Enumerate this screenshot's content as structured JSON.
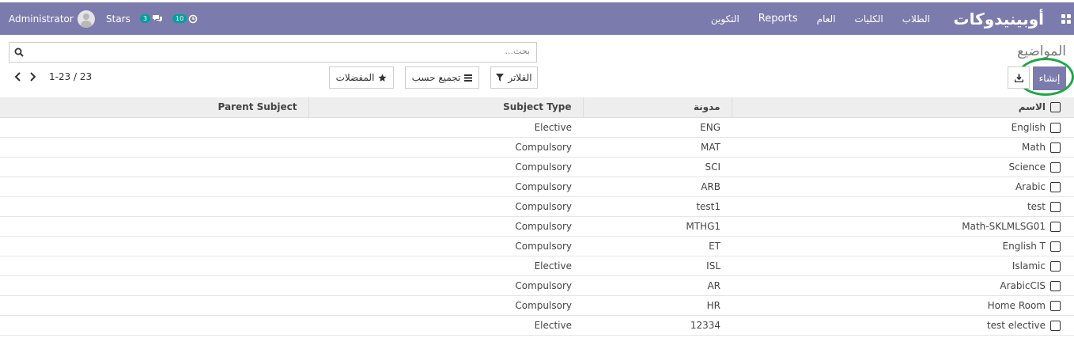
{
  "navbar": {
    "brand": "أوبينيدوكات",
    "menu": [
      {
        "label": "الطلاب"
      },
      {
        "label": "الكليات"
      },
      {
        "label": "العام"
      },
      {
        "label": "Reports"
      },
      {
        "label": "التكوين"
      }
    ],
    "activity_count": "10",
    "messages_count": "3",
    "company": "Stars",
    "user": "Administrator"
  },
  "page": {
    "title": "المواضيع"
  },
  "search": {
    "placeholder": "بحث..."
  },
  "toolbar": {
    "create_label": "إنشاء",
    "filters_label": "الفلاتر",
    "groupby_label": "تجميع حسب",
    "favorites_label": "المفضلات"
  },
  "pager": {
    "value": "1-23 / 23"
  },
  "table": {
    "headers": {
      "name": "الاسم",
      "code": "مدونة",
      "type": "Subject Type",
      "parent": "Parent Subject"
    },
    "rows": [
      {
        "name": "English",
        "code": "ENG",
        "type": "Elective",
        "parent": ""
      },
      {
        "name": "Math",
        "code": "MAT",
        "type": "Compulsory",
        "parent": ""
      },
      {
        "name": "Science",
        "code": "SCI",
        "type": "Compulsory",
        "parent": ""
      },
      {
        "name": "Arabic",
        "code": "ARB",
        "type": "Compulsory",
        "parent": ""
      },
      {
        "name": "test",
        "code": "test1",
        "type": "Compulsory",
        "parent": ""
      },
      {
        "name": "Math-SKLMLSG01",
        "code": "MTHG1",
        "type": "Compulsory",
        "parent": ""
      },
      {
        "name": "English T",
        "code": "ET",
        "type": "Compulsory",
        "parent": ""
      },
      {
        "name": "Islamic",
        "code": "ISL",
        "type": "Elective",
        "parent": ""
      },
      {
        "name": "ArabicCIS",
        "code": "AR",
        "type": "Compulsory",
        "parent": ""
      },
      {
        "name": "Home Room",
        "code": "HR",
        "type": "Compulsory",
        "parent": ""
      },
      {
        "name": "test elective",
        "code": "12334",
        "type": "Elective",
        "parent": ""
      }
    ]
  },
  "colors": {
    "navbar": "#7c7bad",
    "badge": "#00a09d",
    "highlight": "#1fa64a"
  }
}
